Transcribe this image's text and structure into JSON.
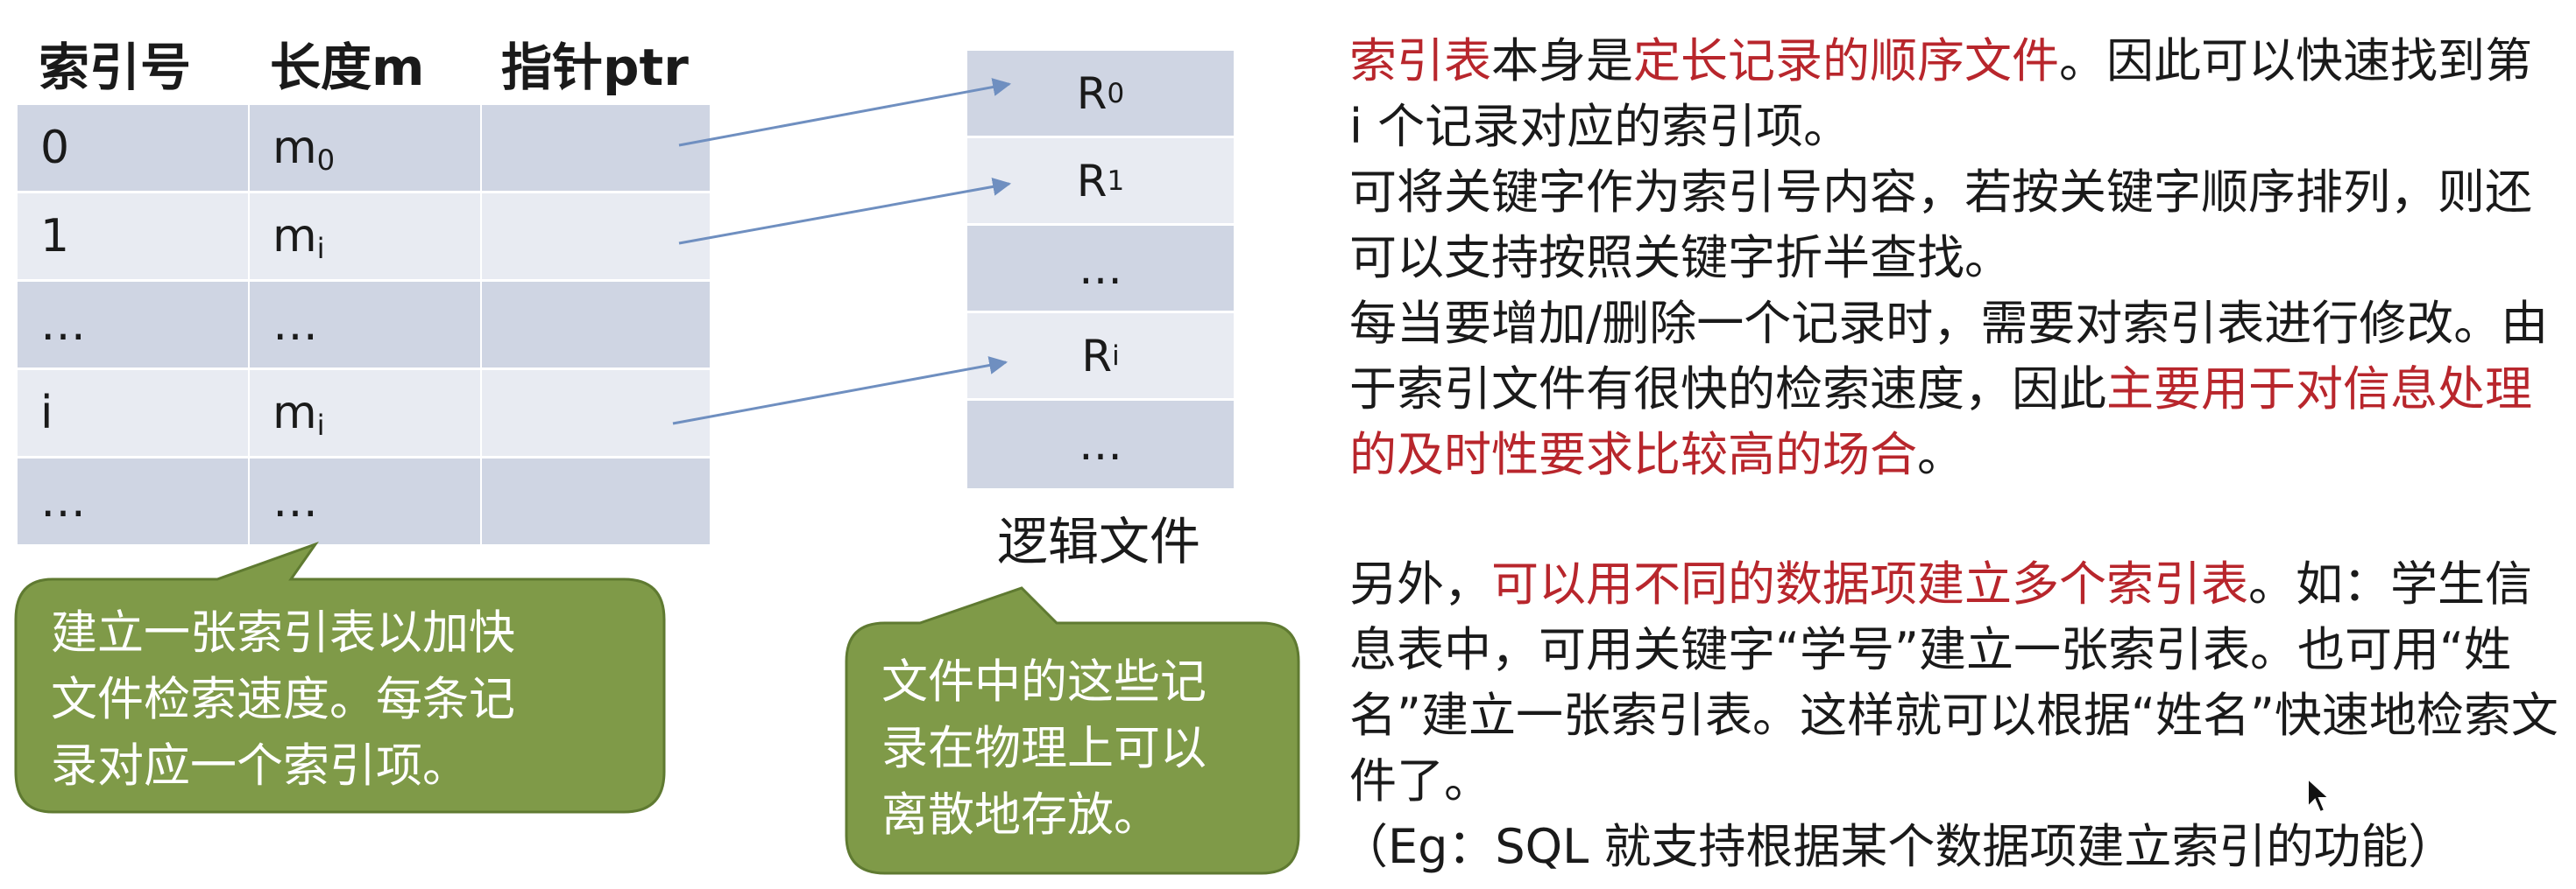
{
  "index_table": {
    "headers": [
      "索引号",
      "长度m",
      "指针ptr"
    ],
    "rows": [
      {
        "index": "0",
        "len_base": "m",
        "len_sub": "0"
      },
      {
        "index": "1",
        "len_base": "m",
        "len_sub": "i"
      },
      {
        "index": "…",
        "len_base": "…",
        "len_sub": ""
      },
      {
        "index": "i",
        "len_base": "m",
        "len_sub": "i"
      },
      {
        "index": "…",
        "len_base": "…",
        "len_sub": ""
      }
    ]
  },
  "logical_file": {
    "label": "逻辑文件",
    "records": [
      {
        "base": "R",
        "sub": "0"
      },
      {
        "base": "R",
        "sub": "1"
      },
      {
        "base": "…",
        "sub": ""
      },
      {
        "base": "R",
        "sub": "i"
      },
      {
        "base": "…",
        "sub": ""
      }
    ]
  },
  "callouts": {
    "index_note_lines": [
      "建立一张索引表以加快",
      "文件检索速度。每条记",
      "录对应一个索引项。"
    ],
    "file_note_lines": [
      "文件中的这些记",
      "录在物理上可以",
      "离散地存放。"
    ]
  },
  "paragraphs": {
    "p1_a": "索引表",
    "p1_b": "本身是",
    "p1_c": "定长记录的顺序文件",
    "p1_d": "。因此可以快速找到第 i 个记录对应的索引项。",
    "p2": "可将关键字作为索引号内容，若按关键字顺序排列，则还可以支持按照关键字折半查找。",
    "p3_a": "每当要增加/删除一个记录时，需要对索引表进行修改。由于索引文件有很快的检索速度，因此",
    "p3_b": "主要用于对信息处理的及时性要求比较高的场合",
    "p3_c": "。",
    "p4_a": "另外，",
    "p4_b": "可以用不同的数据项建立多个索引表",
    "p4_c": "。如：学生信息表中，可用关键字“学号”建立一张索引表。也可用“姓名”建立一张索引表。这样就可以根据“姓名”快速地检索文件了。",
    "p5": "（Eg：SQL 就支持根据某个数据项建立索引的功能）"
  },
  "colors": {
    "table_dark": "#cfd5e3",
    "table_light": "#e8ebf2",
    "bubble_fill": "#7f9a48",
    "bubble_stroke": "#5f7a31",
    "arrow": "#6f8fc0",
    "highlight_text": "#b8262c"
  }
}
